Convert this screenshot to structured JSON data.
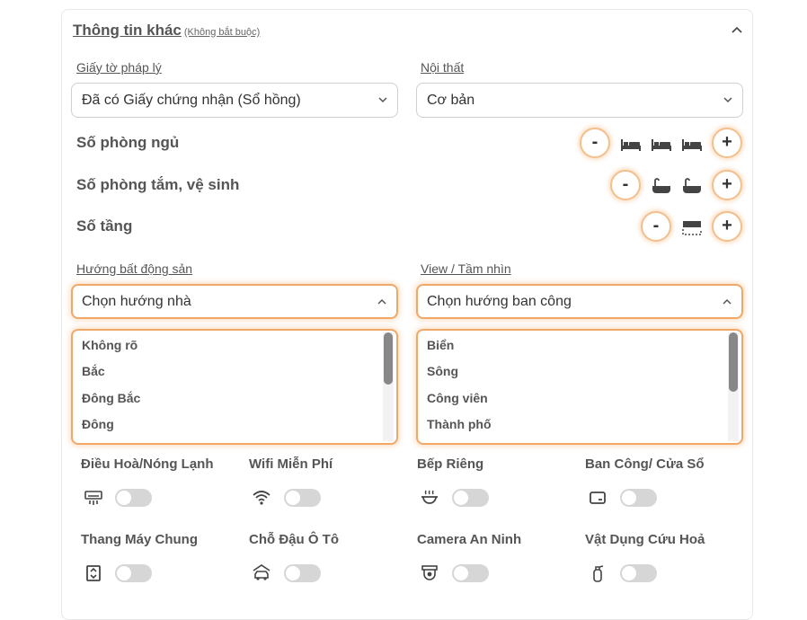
{
  "header": {
    "title": "Thông tin khác",
    "optional": "(Không bắt buộc)"
  },
  "legal": {
    "label": "Giấy tờ pháp lý",
    "value": "Đã có Giấy chứng nhận (Sổ hồng)"
  },
  "furniture": {
    "label": "Nội thất",
    "value": "Cơ bản"
  },
  "counters": {
    "bedrooms": {
      "label": "Số phòng ngủ",
      "minus": "-",
      "plus": "+",
      "count": 3,
      "icon": "bed-icon"
    },
    "bathrooms": {
      "label": "Số phòng tắm, vệ sinh",
      "minus": "-",
      "plus": "+",
      "count": 2,
      "icon": "bathtub-icon"
    },
    "floors": {
      "label": "Số tầng",
      "minus": "-",
      "plus": "+",
      "count": 1,
      "icon": "floor-icon"
    }
  },
  "direction": {
    "label": "Hướng bất động sản",
    "placeholder": "Chọn hướng nhà",
    "options": [
      "Không rõ",
      "Bắc",
      "Đông Bắc",
      "Đông"
    ]
  },
  "view": {
    "label": "View / Tầm nhìn",
    "placeholder": "Chọn hướng ban công",
    "options": [
      "Biển",
      "Sông",
      "Công viên",
      "Thành phố"
    ]
  },
  "amenities": [
    {
      "label": "Điều Hoà/Nóng Lạnh",
      "icon": "air-conditioner-icon",
      "enabled": false
    },
    {
      "label": "Wifi Miễn Phí",
      "icon": "wifi-icon",
      "enabled": false
    },
    {
      "label": "Bếp Riêng",
      "icon": "kitchen-pot-icon",
      "enabled": false
    },
    {
      "label": "Ban Công/ Cửa Sổ",
      "icon": "window-icon",
      "enabled": false
    },
    {
      "label": "Thang Máy Chung",
      "icon": "elevator-icon",
      "enabled": false
    },
    {
      "label": "Chỗ Đậu Ô Tô",
      "icon": "car-parking-icon",
      "enabled": false
    },
    {
      "label": "Camera An Ninh",
      "icon": "security-camera-icon",
      "enabled": false
    },
    {
      "label": "Vật Dụng Cứu Hoả",
      "icon": "fire-extinguisher-icon",
      "enabled": false
    }
  ],
  "colors": {
    "accent": "#f0a868",
    "toggle_off": "#d6d6d6",
    "text": "#555555"
  }
}
